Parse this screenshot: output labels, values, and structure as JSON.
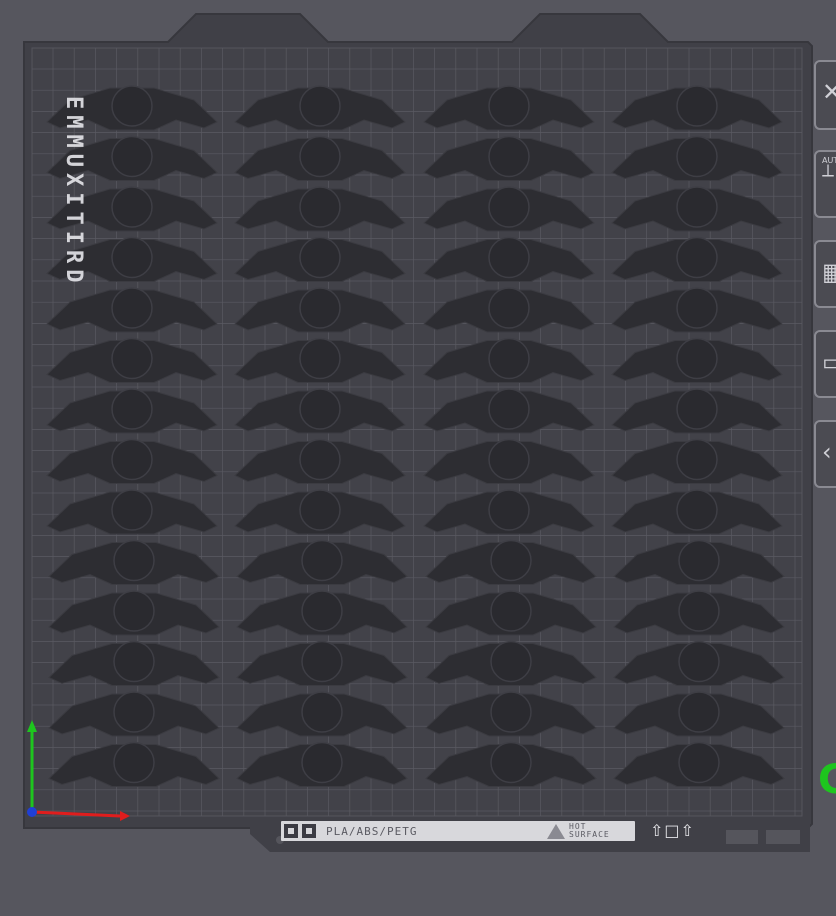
{
  "bed": {
    "material_label": "PLA/ABS/PETG",
    "hot_surface_label": "HOT SURFACE",
    "bed_color": "#404047",
    "border_color": "#37373d",
    "grid_color": "#5a5a62",
    "part_color": "#2d2d32",
    "part_edge_color": "#3b3b41"
  },
  "overlay": {
    "vertical_text": "EMMUXITIRD"
  },
  "axes": {
    "x_color": "#e01d1d",
    "y_color": "#1ec51e",
    "origin_color": "#1f3fd6"
  },
  "objects": {
    "columns": 4,
    "rows": 14
  },
  "toolbar": {
    "items": [
      {
        "icon": "close-icon"
      },
      {
        "icon": "auto-orient-icon",
        "label": "AUT"
      },
      {
        "icon": "arrange-icon"
      },
      {
        "icon": "plate-icon"
      },
      {
        "icon": "collapse-icon"
      }
    ]
  },
  "right_edge_glyph": "G"
}
